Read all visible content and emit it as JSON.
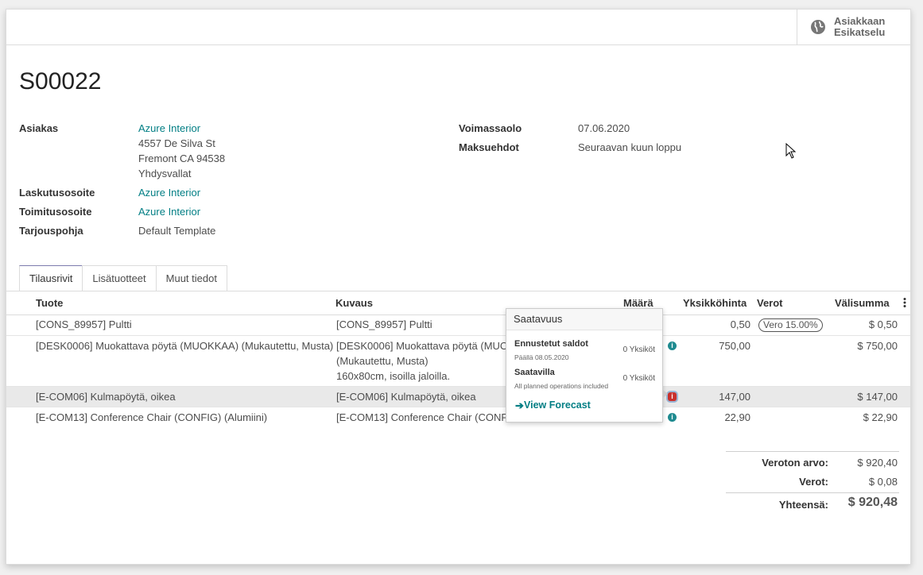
{
  "header": {
    "preview_line1": "Asiakkaan",
    "preview_line2": "Esikatselu"
  },
  "order": {
    "name": "S00022",
    "fields": {
      "customer_label": "Asiakas",
      "customer_name": "Azure Interior",
      "customer_address": [
        "4557 De Silva St",
        "Fremont CA 94538",
        "Yhdysvallat"
      ],
      "invoice_label": "Laskutusosoite",
      "invoice_value": "Azure Interior",
      "delivery_label": "Toimitusosoite",
      "delivery_value": "Azure Interior",
      "template_label": "Tarjouspohja",
      "template_value": "Default Template",
      "validity_label": "Voimassaolo",
      "validity_value": "07.06.2020",
      "terms_label": "Maksuehdot",
      "terms_value": "Seuraavan kuun loppu"
    }
  },
  "tabs": [
    "Tilausrivit",
    "Lisätuotteet",
    "Muut tiedot"
  ],
  "columns": [
    "Tuote",
    "Kuvaus",
    "Määrä",
    "Yksikköhinta",
    "Verot",
    "Välisumma"
  ],
  "lines": [
    {
      "product": "[CONS_89957] Pultti",
      "desc": [
        "[CONS_89957] Pultti"
      ],
      "price": "0,50",
      "tax": "Vero 15.00%",
      "subtotal": "$ 0,50"
    },
    {
      "product": "[DESK0006] Muokattava pöytä (MUOKKAA) (Mukautettu, Musta)",
      "desc": [
        "[DESK0006] Muokattava pöytä (MUOK",
        "(Mukautettu, Musta)",
        "160x80cm, isoilla jaloilla."
      ],
      "price": "750,00",
      "tax": "",
      "subtotal": "$ 750,00"
    },
    {
      "product": "[E-COM06] Kulmapöytä, oikea",
      "desc": [
        "[E-COM06] Kulmapöytä, oikea"
      ],
      "price": "147,00",
      "tax": "",
      "subtotal": "$ 147,00"
    },
    {
      "product": "[E-COM13] Conference Chair (CONFIG) (Alumiini)",
      "desc": [
        "[E-COM13] Conference Chair (CONFIG"
      ],
      "price": "22,90",
      "tax": "",
      "subtotal": "$ 22,90"
    }
  ],
  "totals": {
    "untaxed_label": "Veroton arvo:",
    "untaxed_value": "$ 920,40",
    "taxes_label": "Verot:",
    "taxes_value": "$ 0,08",
    "total_label": "Yhteensä:",
    "total_value": "$ 920,48"
  },
  "popover": {
    "title": "Saatavuus",
    "forecast_label": "Ennustetut saldot",
    "forecast_sub": "Päällä 08.05.2020",
    "forecast_value": "0 Yksiköt",
    "available_label": "Saatavilla",
    "available_sub": "All planned operations included",
    "available_value": "0 Yksiköt",
    "link": "View Forecast"
  }
}
